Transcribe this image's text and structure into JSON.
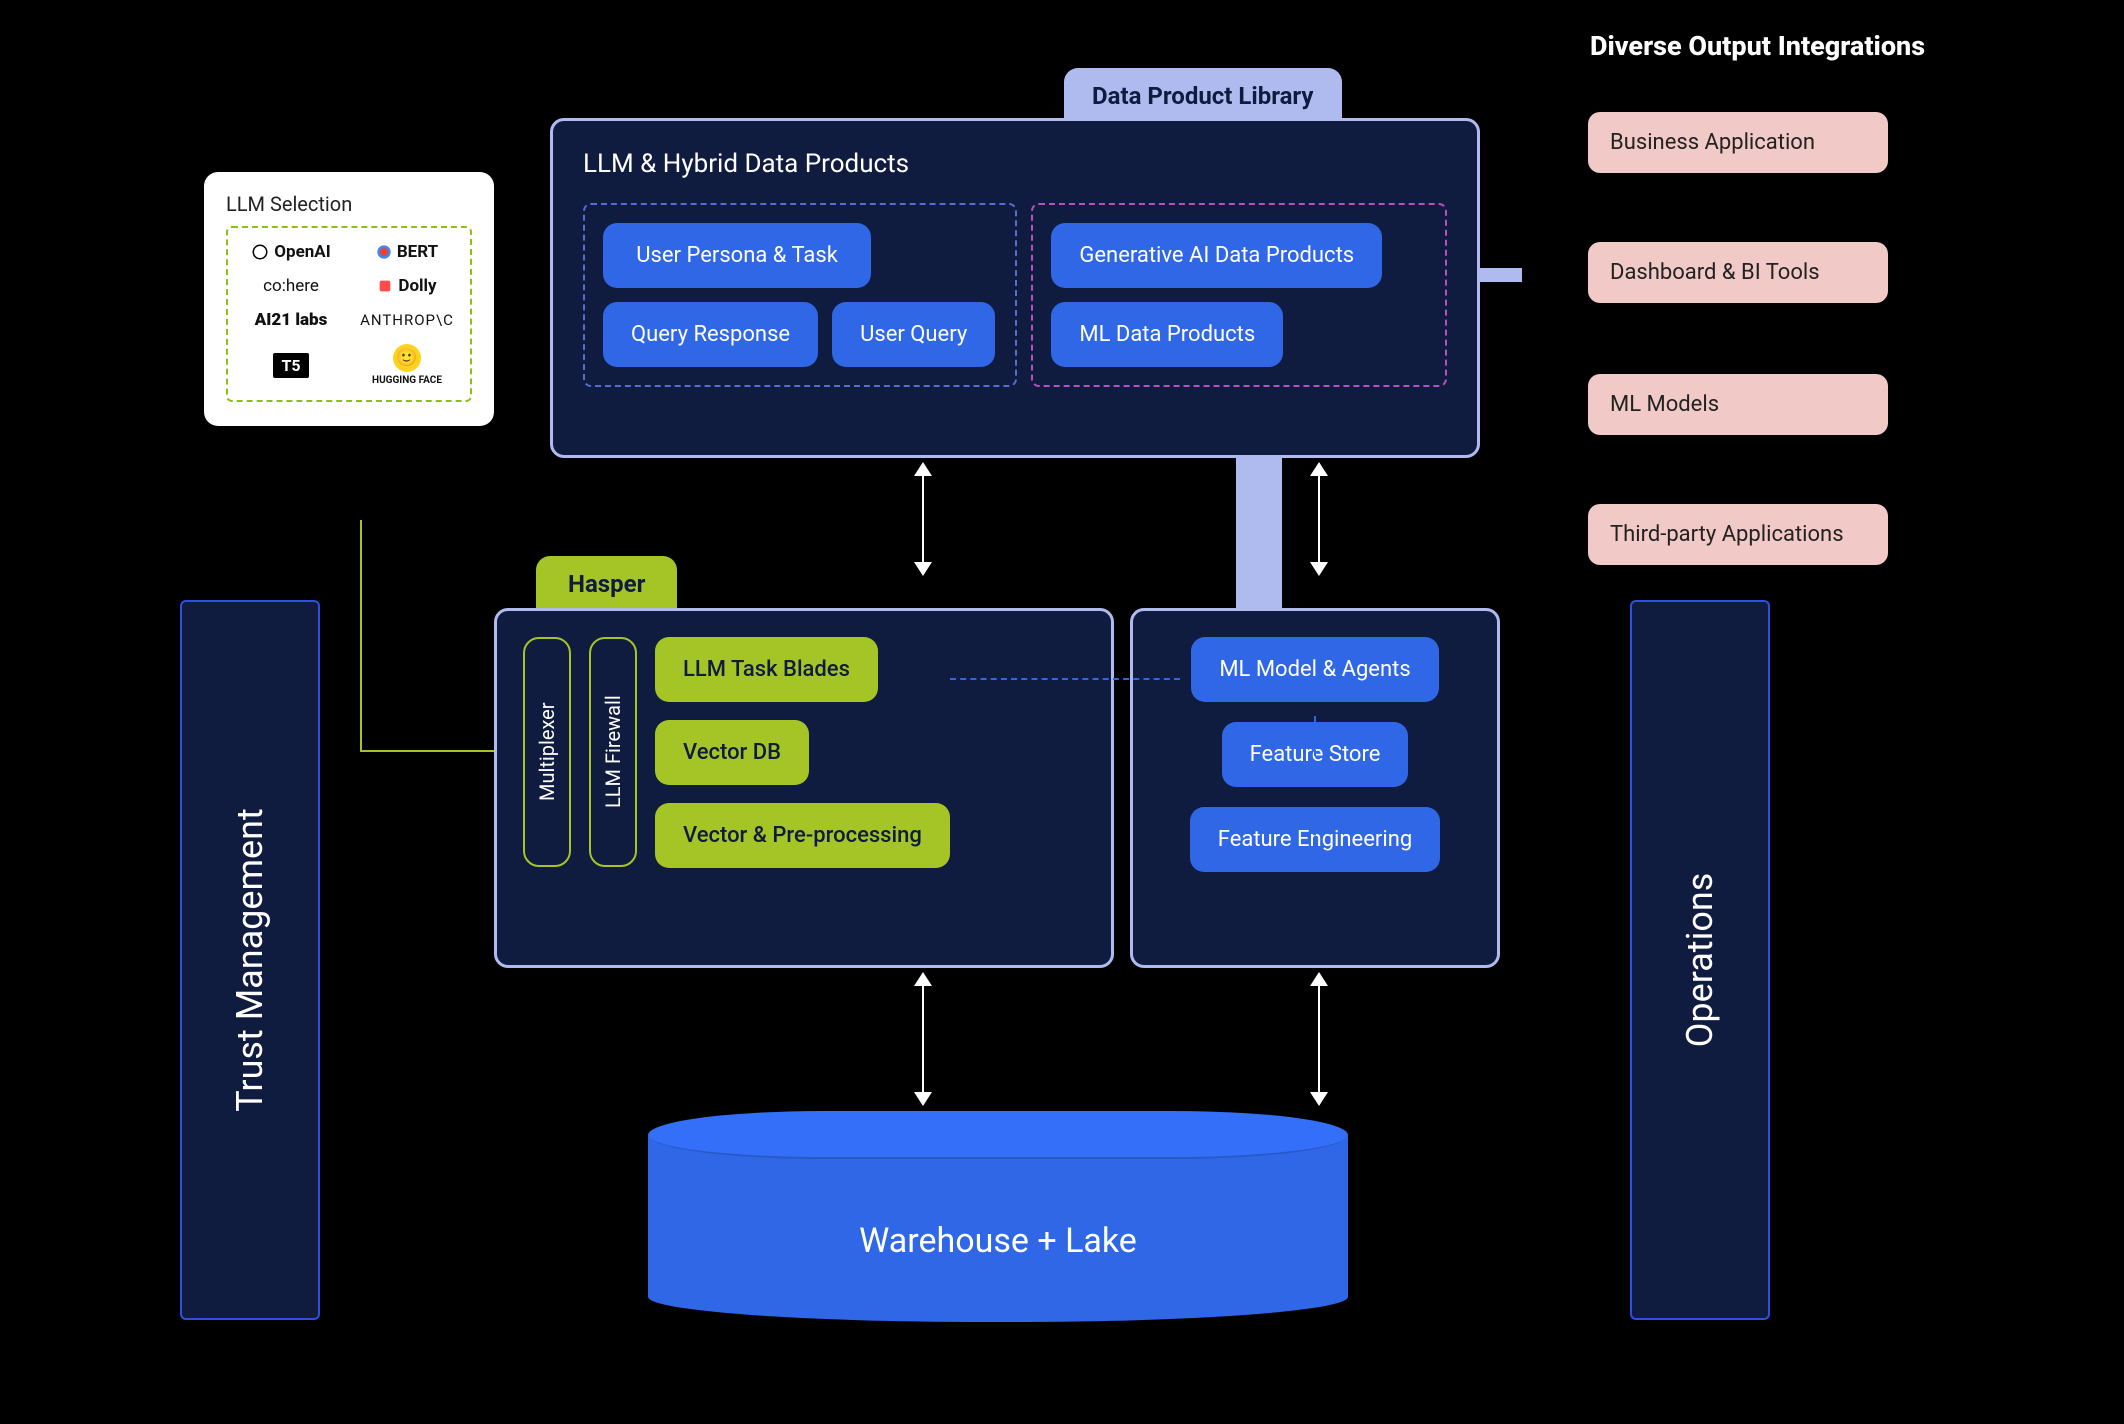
{
  "llm_selection": {
    "title": "LLM Selection",
    "logos": [
      "OpenAI",
      "BERT",
      "co:here",
      "Dolly",
      "AI21 labs",
      "ANTHROP\\C",
      "T5",
      "HUGGING FACE"
    ]
  },
  "library": {
    "tab": "Data  Product Library",
    "panel_title": "LLM & Hybrid Data Products",
    "left_group": [
      "User Persona & Task",
      "Query Response",
      "User Query"
    ],
    "right_group": [
      "Generative AI Data Products",
      "ML Data Products"
    ]
  },
  "hasper": {
    "tab": "Hasper",
    "vertical": [
      "Multiplexer",
      "LLM Firewall"
    ],
    "chips": [
      "LLM Task Blades",
      "Vector DB",
      "Vector & Pre-processing"
    ]
  },
  "ml_panel": {
    "chips": [
      "ML Model & Agents",
      "Feature Store",
      "Feature Engineering"
    ]
  },
  "integrations": {
    "title": "Diverse Output Integrations",
    "items": [
      "Business Application",
      "Dashboard & BI Tools",
      "ML Models",
      "Third-party Applications"
    ]
  },
  "pillars": {
    "left": "Trust Management",
    "right": "Operations"
  },
  "warehouse": "Warehouse + Lake"
}
